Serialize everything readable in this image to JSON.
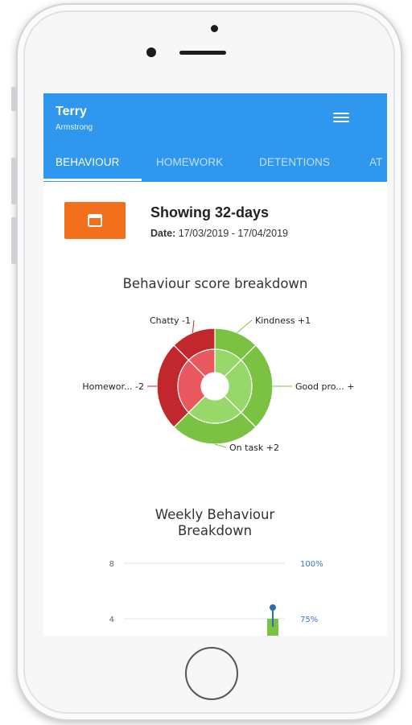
{
  "student": {
    "first_name": "Terry",
    "last_name": "Armstrong"
  },
  "tabs": [
    {
      "label": "BEHAVIOUR",
      "active": true
    },
    {
      "label": "HOMEWORK",
      "active": false
    },
    {
      "label": "DETENTIONS",
      "active": false
    },
    {
      "label": "AT",
      "active": false
    }
  ],
  "summary": {
    "showing": "Showing 32-days",
    "date_label": "Date:",
    "date_range": "17/03/2019 - 17/04/2019"
  },
  "colors": {
    "app_bar": "#2f97ee",
    "calendar_button": "#f26f1d",
    "positive_outer": "#7cc242",
    "positive_inner": "#98d86a",
    "negative_outer": "#c1272d",
    "negative_inner": "#e9575f",
    "weekly_bar": "#7cc242",
    "weekly_marker": "#2a6fb3"
  },
  "icons": {
    "menu": "hamburger-menu-icon",
    "calendar": "calendar-icon"
  },
  "chart_data": [
    {
      "type": "pie",
      "title": "Behaviour score breakdown",
      "slices": [
        {
          "label": "Kindness +1",
          "value": 1,
          "sentiment": "positive"
        },
        {
          "label": "Good pro... +",
          "value": 2,
          "sentiment": "positive"
        },
        {
          "label": "On task +2",
          "value": 2,
          "sentiment": "positive"
        },
        {
          "label": "Homewor... -2",
          "value": 2,
          "sentiment": "negative"
        },
        {
          "label": "Chatty -1",
          "value": 1,
          "sentiment": "negative"
        }
      ]
    },
    {
      "type": "bar",
      "title": "Weekly Behaviour Breakdown",
      "y_ticks_left": [
        "8",
        "4"
      ],
      "y_ticks_right": [
        "100%",
        "75%"
      ],
      "ylim": [
        0,
        8
      ],
      "values": [
        4
      ]
    }
  ]
}
